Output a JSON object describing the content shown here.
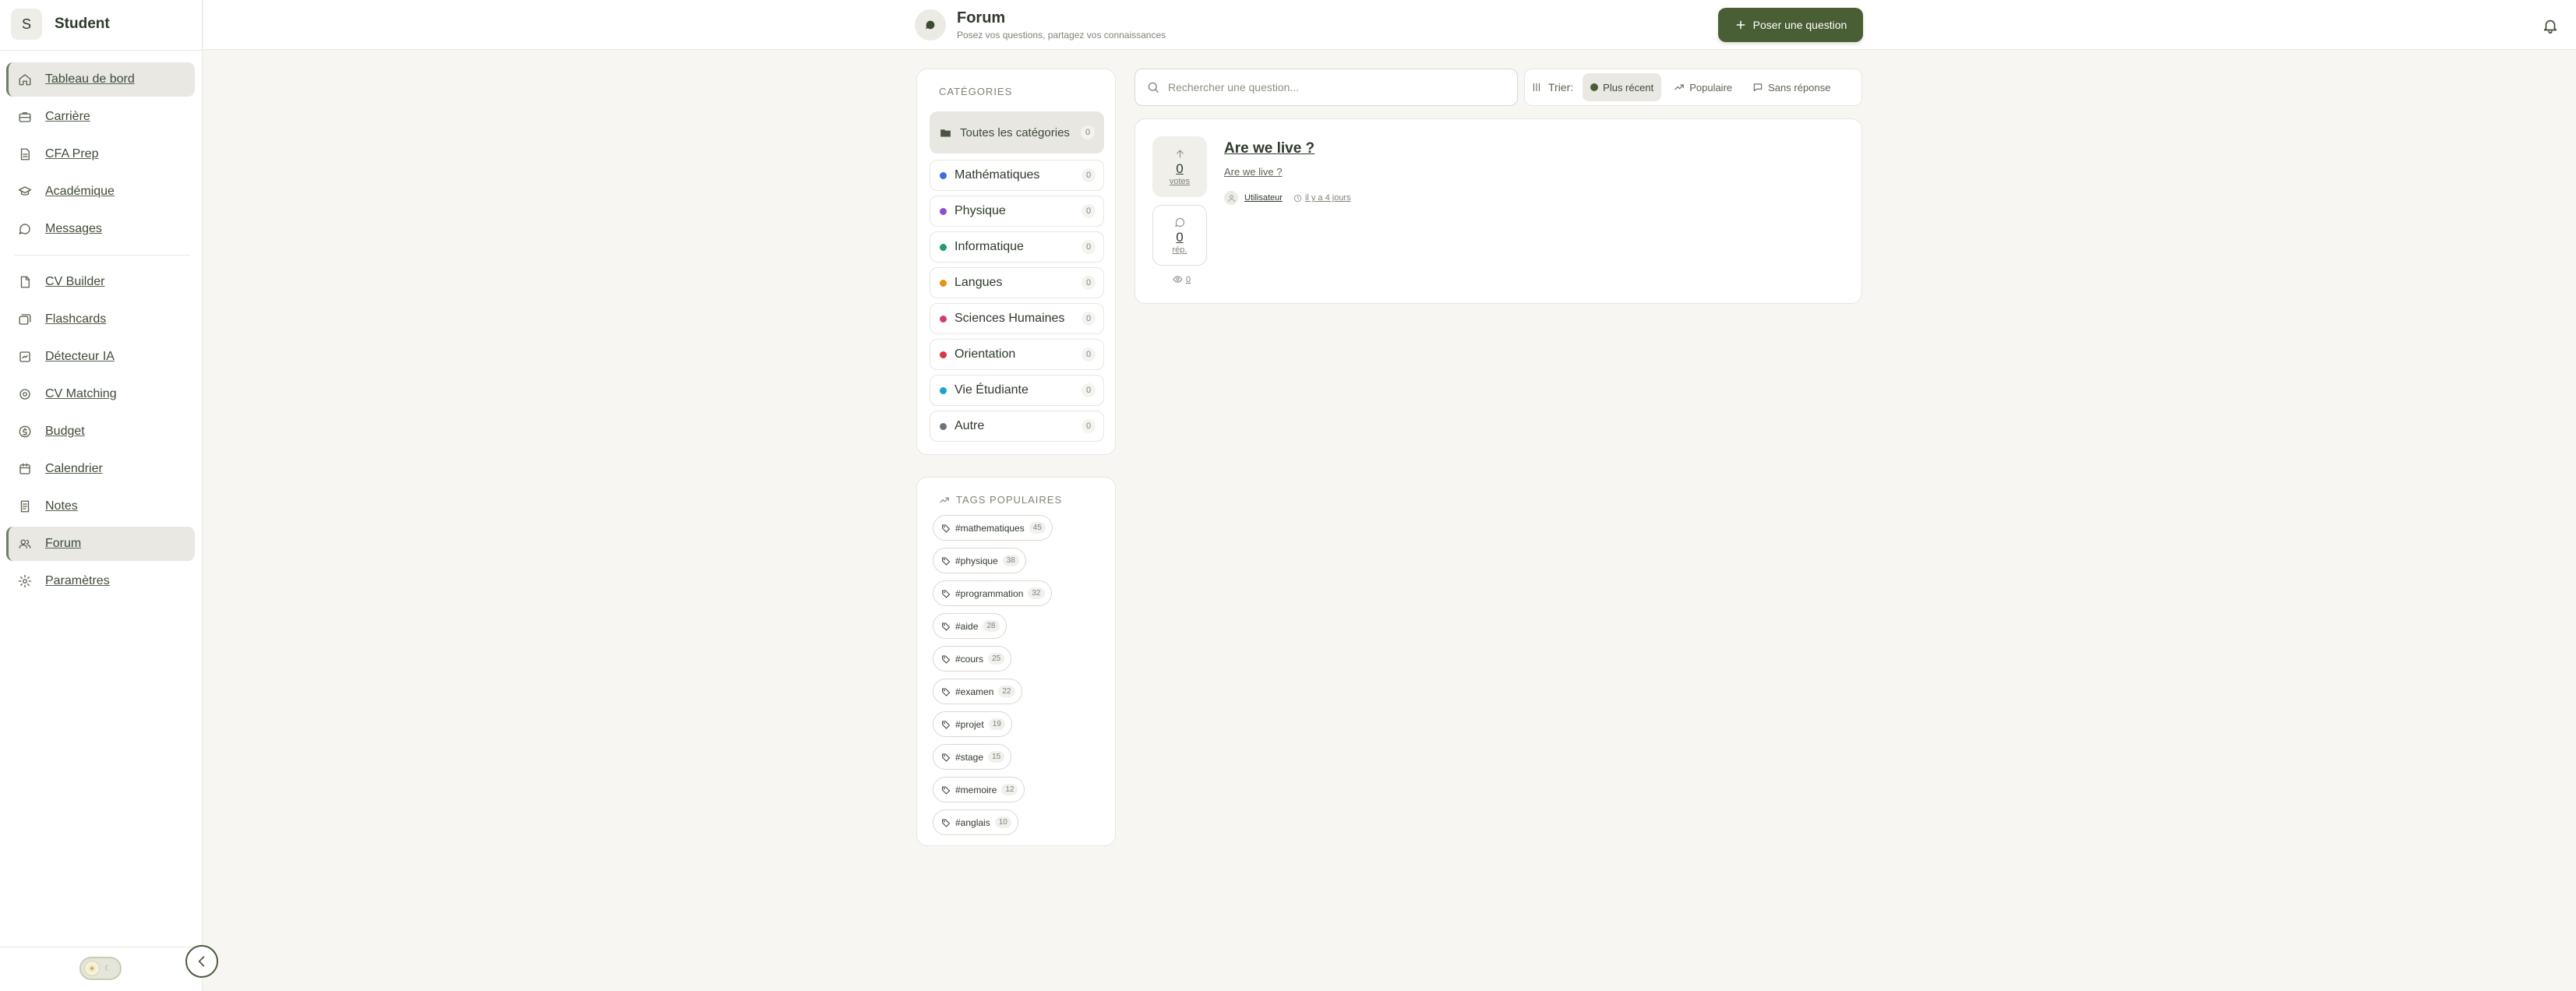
{
  "sidebar": {
    "brand_initial": "S",
    "brand_name": "Student",
    "nav_main": [
      {
        "label": "Tableau de bord",
        "icon": "home-icon",
        "active": true
      },
      {
        "label": "Carrière",
        "icon": "briefcase-icon"
      },
      {
        "label": "CFA Prep",
        "icon": "document-icon"
      },
      {
        "label": "Académique",
        "icon": "graduation-cap-icon"
      },
      {
        "label": "Messages",
        "icon": "message-icon"
      }
    ],
    "nav_tools": [
      {
        "label": "CV Builder",
        "icon": "file-icon"
      },
      {
        "label": "Flashcards",
        "icon": "cards-icon"
      },
      {
        "label": "Détecteur IA",
        "icon": "scan-icon"
      },
      {
        "label": "CV Matching",
        "icon": "target-icon"
      },
      {
        "label": "Budget",
        "icon": "dollar-icon"
      },
      {
        "label": "Calendrier",
        "icon": "calendar-icon"
      },
      {
        "label": "Notes",
        "icon": "note-icon"
      },
      {
        "label": "Forum",
        "icon": "users-icon",
        "active": true
      },
      {
        "label": "Paramètres",
        "icon": "gear-icon"
      }
    ]
  },
  "header": {
    "title": "Forum",
    "subtitle": "Posez vos questions, partagez vos connaissances",
    "ask_button": "Poser une question"
  },
  "categories": {
    "heading": "CATÉGORIES",
    "all": {
      "label": "Toutes les catégories",
      "count": "0"
    },
    "items": [
      {
        "label": "Mathématiques",
        "count": "0",
        "color": "#3b6fd9"
      },
      {
        "label": "Physique",
        "count": "0",
        "color": "#8b4fd6"
      },
      {
        "label": "Informatique",
        "count": "0",
        "color": "#1f9d6b"
      },
      {
        "label": "Langues",
        "count": "0",
        "color": "#e69214"
      },
      {
        "label": "Sciences Humaines",
        "count": "0",
        "color": "#d6397a"
      },
      {
        "label": "Orientation",
        "count": "0",
        "color": "#dc3545"
      },
      {
        "label": "Vie Étudiante",
        "count": "0",
        "color": "#15a6c9"
      },
      {
        "label": "Autre",
        "count": "0",
        "color": "#6b7280"
      }
    ]
  },
  "tags": {
    "heading": "TAGS POPULAIRES",
    "items": [
      {
        "label": "#mathematiques",
        "count": "45"
      },
      {
        "label": "#physique",
        "count": "38"
      },
      {
        "label": "#programmation",
        "count": "32"
      },
      {
        "label": "#aide",
        "count": "28"
      },
      {
        "label": "#cours",
        "count": "25"
      },
      {
        "label": "#examen",
        "count": "22"
      },
      {
        "label": "#projet",
        "count": "19"
      },
      {
        "label": "#stage",
        "count": "15"
      },
      {
        "label": "#memoire",
        "count": "12"
      },
      {
        "label": "#anglais",
        "count": "10"
      }
    ]
  },
  "search": {
    "placeholder": "Rechercher une question..."
  },
  "sort": {
    "label": "Trier:",
    "options": [
      {
        "label": "Plus récent",
        "active": true
      },
      {
        "label": "Populaire"
      },
      {
        "label": "Sans réponse"
      }
    ]
  },
  "question": {
    "title": "Are we live ?",
    "excerpt": "Are we live ?",
    "votes": "0",
    "votes_label": "votes",
    "replies": "0",
    "replies_label": "rép.",
    "views": "0",
    "author": "Utilisateur",
    "time": "il y a 4 jours"
  }
}
